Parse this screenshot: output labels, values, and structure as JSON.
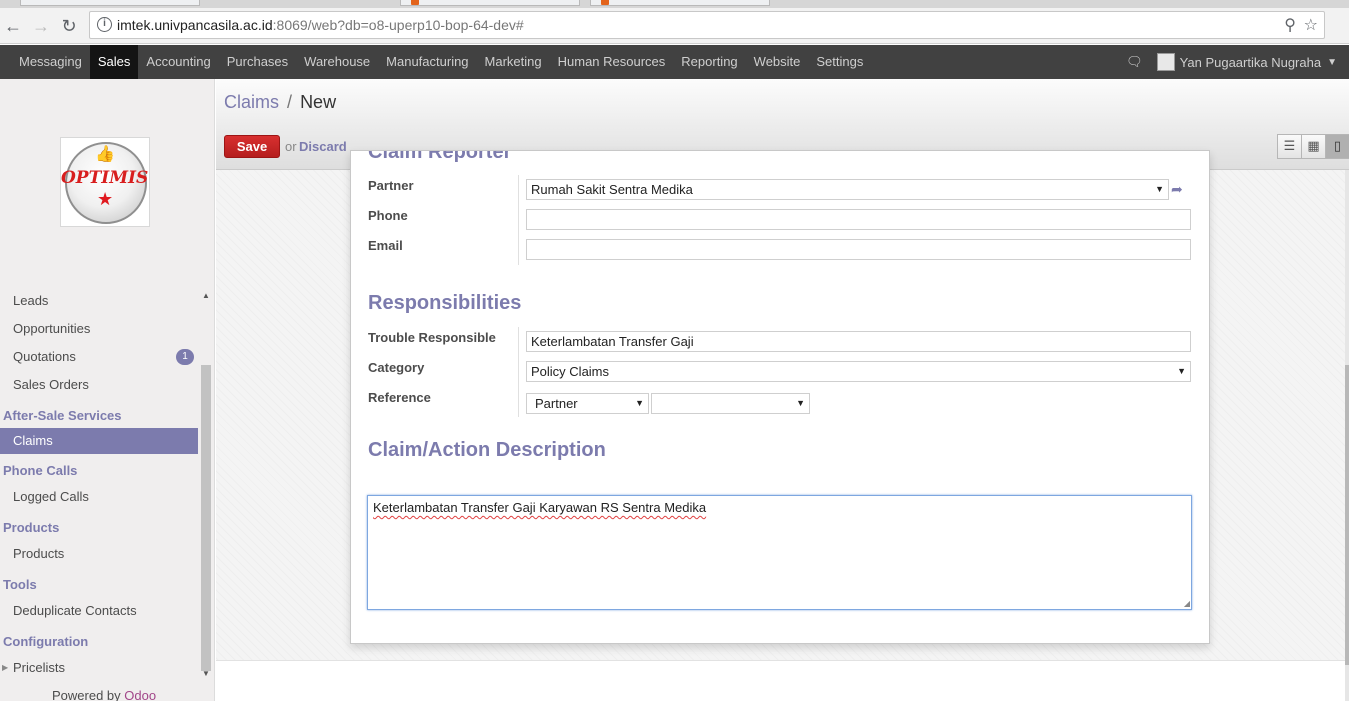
{
  "browser": {
    "url_host": "imtek.univpancasila.ac.id",
    "url_rest": ":8069/web?db=o8-uperp10-bop-64-dev#"
  },
  "topnav": {
    "menu": [
      "Messaging",
      "Sales",
      "Accounting",
      "Purchases",
      "Warehouse",
      "Manufacturing",
      "Marketing",
      "Human Resources",
      "Reporting",
      "Website",
      "Settings"
    ],
    "active": "Sales",
    "user": "Yan Pugaartika Nugraha"
  },
  "logo": {
    "text": "OPTIMIS"
  },
  "sidebar": {
    "leads": "Leads",
    "opportunities": "Opportunities",
    "quotations": "Quotations",
    "quotations_badge": "1",
    "sales_orders": "Sales Orders",
    "after_sale_header": "After-Sale Services",
    "claims": "Claims",
    "phone_calls_header": "Phone Calls",
    "logged_calls": "Logged Calls",
    "products_header": "Products",
    "products": "Products",
    "tools_header": "Tools",
    "dedup": "Deduplicate Contacts",
    "config_header": "Configuration",
    "pricelists": "Pricelists",
    "powered_by": "Powered by",
    "odoo": "Odoo"
  },
  "control_panel": {
    "breadcrumb_parent": "Claims",
    "breadcrumb_sep": "/",
    "breadcrumb_current": "New",
    "save_label": "Save",
    "or_label": "or",
    "discard_label": "Discard"
  },
  "form": {
    "claim_reporter_title": "Claim Reporter",
    "partner_label": "Partner",
    "partner_value": "Rumah Sakit Sentra Medika",
    "phone_label": "Phone",
    "phone_value": "",
    "email_label": "Email",
    "email_value": "",
    "responsibilities_title": "Responsibilities",
    "trouble_label": "Trouble Responsible",
    "trouble_value": "Keterlambatan Transfer Gaji",
    "category_label": "Category",
    "category_value": "Policy Claims",
    "reference_label": "Reference",
    "reference_model": "Partner",
    "reference_record": "",
    "description_title": "Claim/Action Description",
    "description_value": "Keterlambatan Transfer Gaji Karyawan RS Sentra Medika"
  }
}
